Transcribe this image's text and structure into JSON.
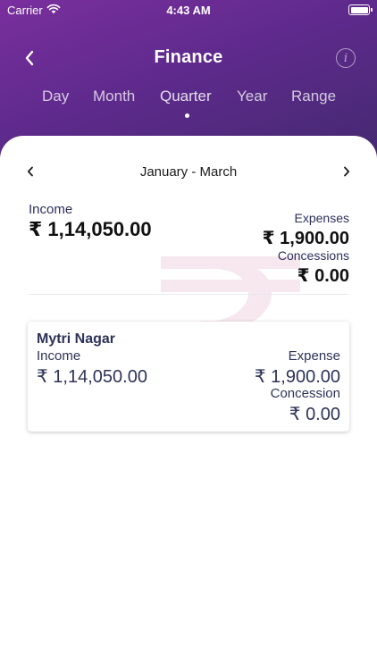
{
  "status_bar": {
    "carrier": "Carrier",
    "time": "4:43 AM"
  },
  "nav": {
    "title": "Finance",
    "info_icon": "i"
  },
  "tabs": [
    {
      "label": "Day"
    },
    {
      "label": "Month"
    },
    {
      "label": "Quarter",
      "active": true
    },
    {
      "label": "Year"
    },
    {
      "label": "Range"
    }
  ],
  "period": {
    "label": "January - March"
  },
  "summary": {
    "income_label": "Income",
    "income_value": "₹ 1,14,050.00",
    "expenses_label": "Expenses",
    "expenses_value": "₹ 1,900.00",
    "concessions_label": "Concessions",
    "concessions_value": "₹ 0.00"
  },
  "branches": [
    {
      "name": "Mytri Nagar",
      "income_label": "Income",
      "income_value": "₹ 1,14,050.00",
      "expense_label": "Expense",
      "expense_value": "₹ 1,900.00",
      "concession_label": "Concession",
      "concession_value": "₹ 0.00"
    }
  ],
  "colors": {
    "header_gradient_start": "#7a2f9e",
    "header_gradient_end": "#43296f",
    "label_text": "#2c2f5c",
    "watermark": "#f6e8ee"
  }
}
